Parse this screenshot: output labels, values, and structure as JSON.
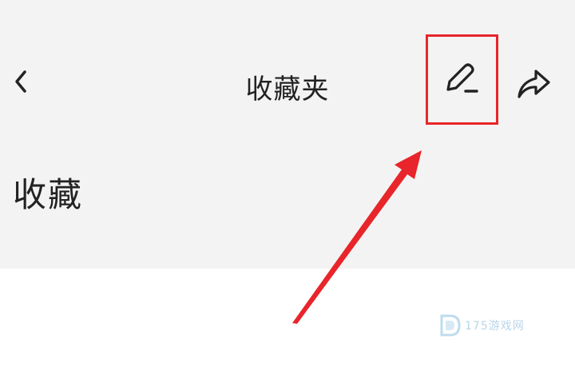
{
  "header": {
    "title": "收藏夹",
    "back_icon": "chevron-left-icon",
    "edit_icon": "pencil-icon",
    "share_icon": "share-arrow-icon"
  },
  "section": {
    "title": "收藏"
  },
  "annotation": {
    "highlight_color": "#e8252a",
    "target": "edit-button"
  },
  "watermark": {
    "text": "175游戏网"
  },
  "colors": {
    "top_background": "#f3f3f3",
    "content_background": "#ffffff",
    "text": "#222222",
    "accent_red": "#e8252a"
  }
}
